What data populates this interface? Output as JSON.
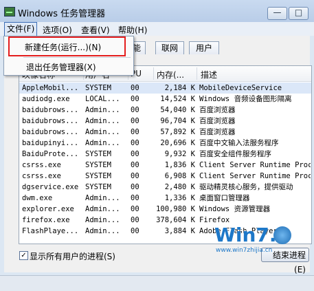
{
  "window": {
    "title": "Windows 任务管理器"
  },
  "title_buttons": {
    "minimize": "—",
    "maximize": "□"
  },
  "menu": {
    "file": "文件(F)",
    "options": "选项(O)",
    "view": "查看(V)",
    "help": "帮助(H)"
  },
  "file_menu": {
    "new_task": "新建任务(运行...)(N)",
    "exit": "退出任务管理器(X)"
  },
  "tabs": {
    "performance_partial": "能",
    "network": "联网",
    "users": "用户"
  },
  "columns": {
    "image_partial": "映像名称",
    "user_partial": "用户名",
    "cpu_partial": "PU",
    "memory": "内存(...",
    "description": "描述"
  },
  "rows": [
    {
      "image": "AppleMobil...",
      "user": "SYSTEM",
      "cpu": "00",
      "mem": "2,184 K",
      "desc": "MobileDeviceService"
    },
    {
      "image": "audiodg.exe",
      "user": "LOCAL...",
      "cpu": "00",
      "mem": "14,524 K",
      "desc": "Windows 音频设备图形隔离"
    },
    {
      "image": "baidubrows...",
      "user": "Admin...",
      "cpu": "00",
      "mem": "54,040 K",
      "desc": "百度浏览器"
    },
    {
      "image": "baidubrows...",
      "user": "Admin...",
      "cpu": "00",
      "mem": "96,704 K",
      "desc": "百度浏览器"
    },
    {
      "image": "baidubrows...",
      "user": "Admin...",
      "cpu": "00",
      "mem": "57,892 K",
      "desc": "百度浏览器"
    },
    {
      "image": "baidupinyi...",
      "user": "Admin...",
      "cpu": "00",
      "mem": "20,696 K",
      "desc": "百度中文输入法服务程序"
    },
    {
      "image": "BaiduProte...",
      "user": "SYSTEM",
      "cpu": "00",
      "mem": "9,932 K",
      "desc": "百度安全组件服务程序"
    },
    {
      "image": "csrss.exe",
      "user": "SYSTEM",
      "cpu": "00",
      "mem": "1,836 K",
      "desc": "Client Server Runtime Proc"
    },
    {
      "image": "csrss.exe",
      "user": "SYSTEM",
      "cpu": "00",
      "mem": "6,908 K",
      "desc": "Client Server Runtime Proc"
    },
    {
      "image": "dgservice.exe",
      "user": "SYSTEM",
      "cpu": "00",
      "mem": "2,480 K",
      "desc": "驱动精灵核心服务，提供驱动"
    },
    {
      "image": "dwm.exe",
      "user": "Admin...",
      "cpu": "00",
      "mem": "1,336 K",
      "desc": "桌面窗口管理器"
    },
    {
      "image": "explorer.exe",
      "user": "Admin...",
      "cpu": "00",
      "mem": "100,980 K",
      "desc": "Windows 资源管理器"
    },
    {
      "image": "firefox.exe",
      "user": "Admin...",
      "cpu": "00",
      "mem": "378,604 K",
      "desc": "Firefox"
    },
    {
      "image": "FlashPlaye...",
      "user": "Admin...",
      "cpu": "00",
      "mem": "3,884 K",
      "desc": "Adobe Flash Player"
    }
  ],
  "footer": {
    "show_all_users": "显示所有用户的进程(S)",
    "check_mark": "✓",
    "end_process": "结束进程(E)"
  },
  "watermark": {
    "brand": "Win7.",
    "url": "www.win7zhijia.cn"
  }
}
